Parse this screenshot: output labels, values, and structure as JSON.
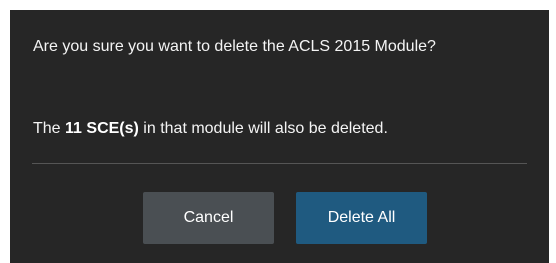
{
  "dialog": {
    "question": "Are you sure you want to delete the ACLS 2015 Module?",
    "detail_prefix": "The",
    "detail_count": "11 SCE(s)",
    "detail_suffix": "in that module will also be deleted.",
    "cancel_label": "Cancel",
    "delete_label": "Delete All"
  },
  "colors": {
    "dialog_bg": "#262626",
    "cancel_bg": "#4a4f53",
    "delete_bg": "#1f5a80"
  }
}
